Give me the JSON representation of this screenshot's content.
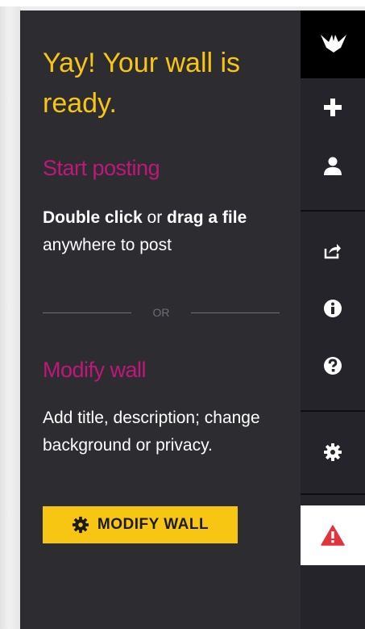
{
  "panel": {
    "headline": "Yay! Your wall is ready.",
    "posting": {
      "title": "Start posting",
      "text": {
        "bold1": "Double click",
        "normal1": " or ",
        "bold2": "drag a file",
        "normal2": " anywhere to post"
      }
    },
    "divider_label": "OR",
    "modify": {
      "title": "Modify wall",
      "description": "Add title, description; change background or privacy.",
      "button_label": "MODIFY WALL",
      "button_icon": "gear-icon"
    }
  },
  "toolbar": {
    "items": [
      {
        "name": "logo",
        "icon": "bird-logo-icon"
      },
      {
        "name": "add-post",
        "icon": "plus-icon"
      },
      {
        "name": "profile",
        "icon": "user-icon"
      },
      {
        "name": "share",
        "icon": "share-icon"
      },
      {
        "name": "info",
        "icon": "info-icon"
      },
      {
        "name": "help",
        "icon": "question-icon"
      },
      {
        "name": "settings",
        "icon": "gear-icon"
      },
      {
        "name": "alert",
        "icon": "warning-icon"
      }
    ]
  },
  "colors": {
    "panel_bg": "#2c2c31",
    "toolbar_bg": "#24242a",
    "accent_yellow": "#f6c612",
    "accent_magenta": "#c0177a",
    "alert_red": "#e4323c"
  }
}
